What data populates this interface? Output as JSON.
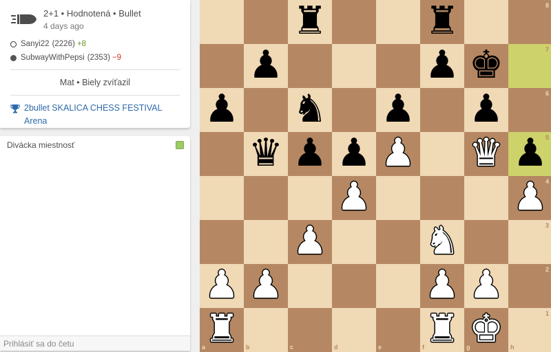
{
  "game": {
    "type": "2+1 • Hodnotená • Bullet",
    "time": "4 days ago",
    "white_player": {
      "name": "Sanyi22",
      "rating": "(2226)",
      "change": "+8"
    },
    "black_player": {
      "name": "SubwayWithPepsi",
      "rating": "(2353)",
      "change": "−9"
    },
    "result": "Mat • Biely zvíťazil",
    "tournament": "2bullet SKALICA CHESS FESTIVAL Arena",
    "icon": "bullet-icon"
  },
  "chat": {
    "title": "Divácka miestnosť",
    "placeholder": "Prihlásiť sa do četu"
  },
  "board": {
    "files": [
      "a",
      "b",
      "c",
      "d",
      "e",
      "f",
      "g",
      "h"
    ],
    "ranks": [
      "8",
      "7",
      "6",
      "5",
      "4",
      "3",
      "2",
      "1"
    ],
    "highlights": [
      "h7",
      "h5"
    ],
    "pieces": [
      {
        "square": "c8",
        "piece": "r"
      },
      {
        "square": "f8",
        "piece": "r"
      },
      {
        "square": "b7",
        "piece": "p"
      },
      {
        "square": "f7",
        "piece": "p"
      },
      {
        "square": "g7",
        "piece": "k"
      },
      {
        "square": "a6",
        "piece": "p"
      },
      {
        "square": "c6",
        "piece": "n"
      },
      {
        "square": "e6",
        "piece": "p"
      },
      {
        "square": "g6",
        "piece": "p"
      },
      {
        "square": "b5",
        "piece": "q"
      },
      {
        "square": "c5",
        "piece": "p"
      },
      {
        "square": "d5",
        "piece": "p"
      },
      {
        "square": "e5",
        "piece": "P"
      },
      {
        "square": "g5",
        "piece": "Q"
      },
      {
        "square": "h5",
        "piece": "p"
      },
      {
        "square": "d4",
        "piece": "P"
      },
      {
        "square": "h4",
        "piece": "P"
      },
      {
        "square": "c3",
        "piece": "P"
      },
      {
        "square": "f3",
        "piece": "N"
      },
      {
        "square": "a2",
        "piece": "P"
      },
      {
        "square": "b2",
        "piece": "P"
      },
      {
        "square": "f2",
        "piece": "P"
      },
      {
        "square": "g2",
        "piece": "P"
      },
      {
        "square": "a1",
        "piece": "R"
      },
      {
        "square": "f1",
        "piece": "R"
      },
      {
        "square": "g1",
        "piece": "K"
      }
    ],
    "colors": {
      "light": "#f0d9b5",
      "dark": "#b58863",
      "highlight_light": "#cdd26a",
      "highlight_dark": "#aaa23a"
    }
  }
}
